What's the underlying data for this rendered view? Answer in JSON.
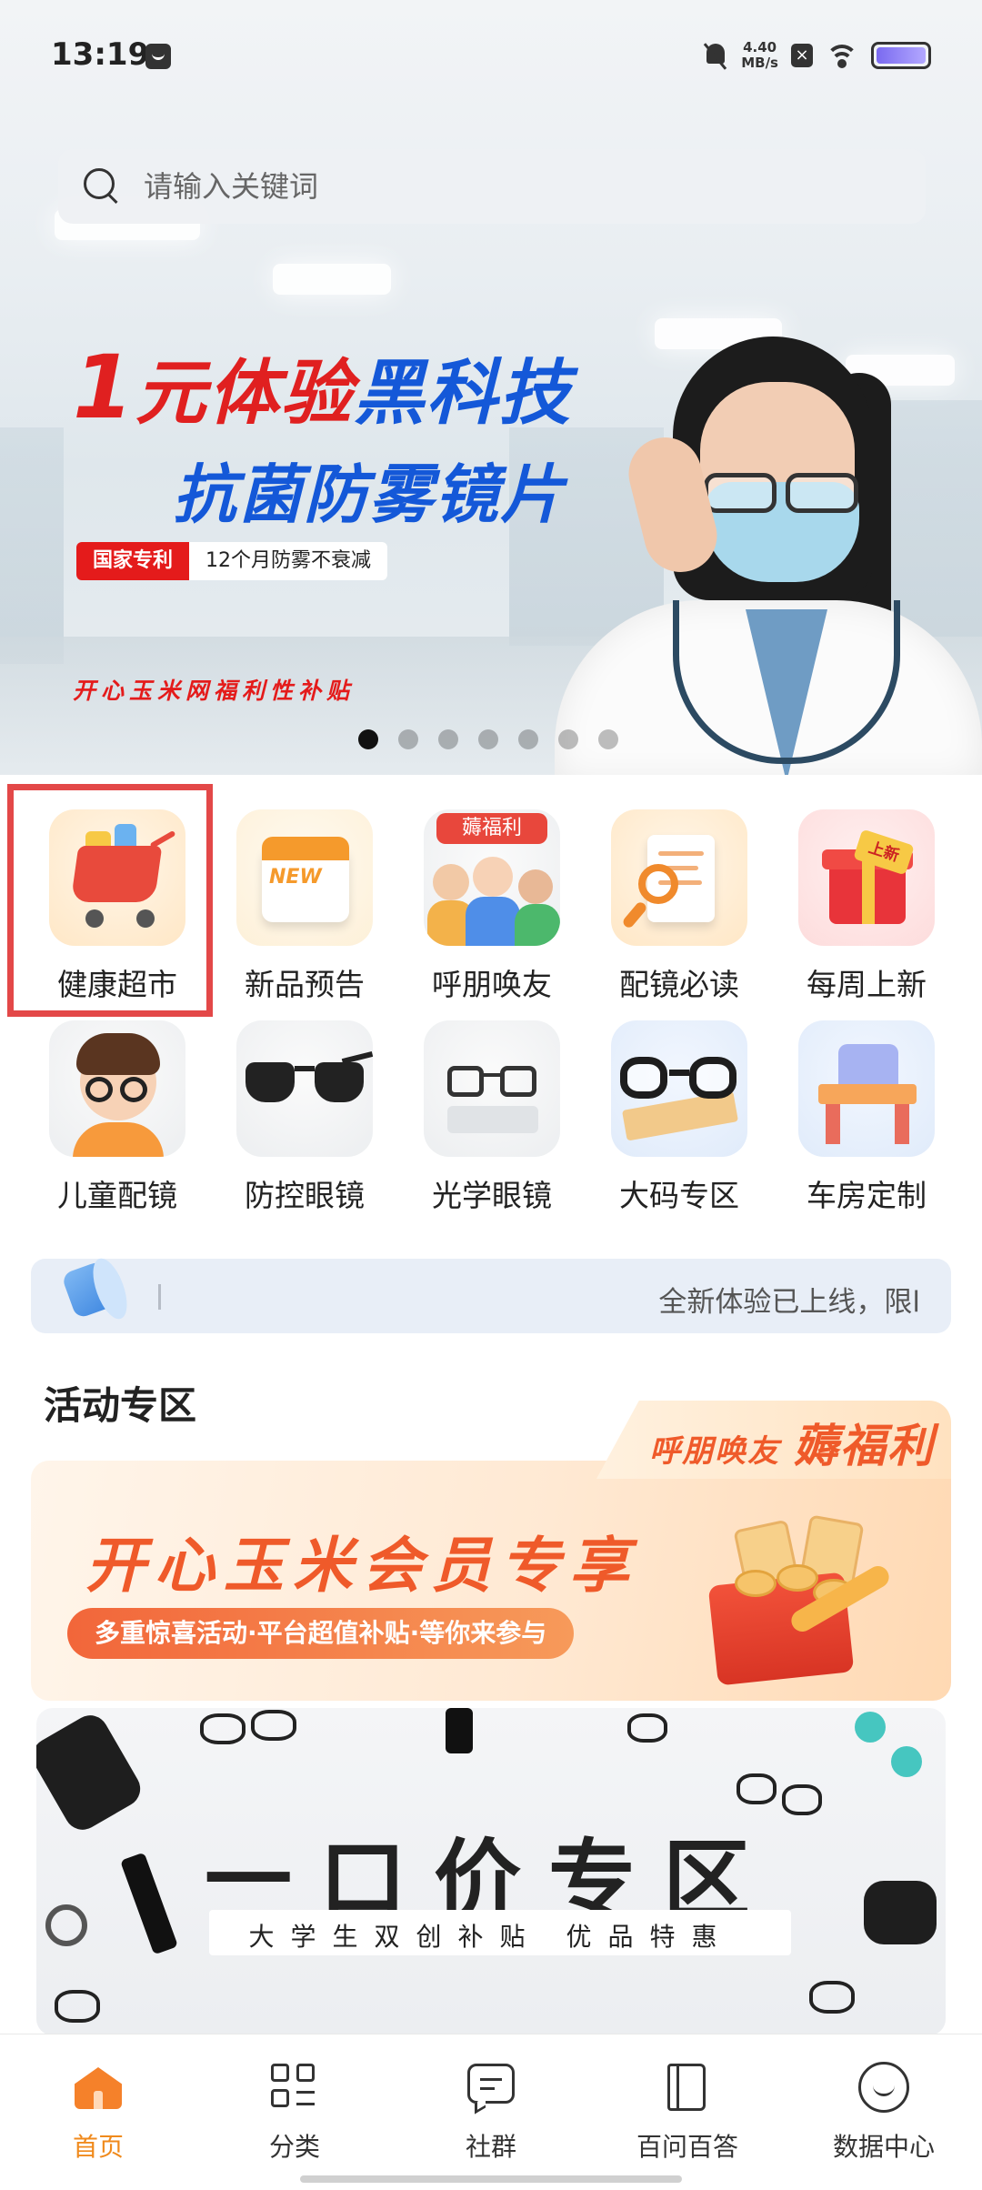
{
  "status_bar": {
    "time": "13:19",
    "net_speed_value": "4.40",
    "net_speed_unit": "MB/s",
    "icons": [
      "message-icon",
      "bell-off-icon",
      "close-box-icon",
      "wifi-icon",
      "battery-icon"
    ]
  },
  "search": {
    "placeholder": "请输入关键词"
  },
  "banner": {
    "headline_num": "1",
    "headline_red": "元体验",
    "headline_blue": "黑科技",
    "headline_line2": "抗菌防雾镜片",
    "tag_red": "国家专利",
    "tag_white": "12个月防雾不衰减",
    "slogan": "开心玉米网福利性补贴",
    "dots_total": 7,
    "dots_active_index": 0
  },
  "grid": {
    "items": [
      {
        "label": "健康超市",
        "icon": "shopping-cart-icon"
      },
      {
        "label": "新品预告",
        "icon": "calendar-new-icon",
        "icon_text": "NEW"
      },
      {
        "label": "呼朋唤友",
        "icon": "friends-icon",
        "badge": "薅福利"
      },
      {
        "label": "配镜必读",
        "icon": "document-magnifier-icon"
      },
      {
        "label": "每周上新",
        "icon": "gift-box-icon",
        "icon_text": "上新"
      },
      {
        "label": "儿童配镜",
        "icon": "kid-glasses-icon"
      },
      {
        "label": "防控眼镜",
        "icon": "sunglasses-icon"
      },
      {
        "label": "光学眼镜",
        "icon": "optical-glasses-icon"
      },
      {
        "label": "大码专区",
        "icon": "large-frame-glasses-icon"
      },
      {
        "label": "车房定制",
        "icon": "workshop-machine-icon"
      }
    ]
  },
  "notice": {
    "text": "全新体验已上线，限l",
    "icon": "megaphone-icon"
  },
  "activity": {
    "section_title": "活动专区",
    "tab_text_small": "呼朋唤友",
    "tab_text_big": "薅福利",
    "promo_title": "开心玉米会员专享",
    "promo_pill": "多重惊喜活动·平台超值补贴·等你来参与",
    "yikou_title": "一口价专区",
    "yikou_sub": "大学生双创补贴  优品特惠"
  },
  "bottom_nav": {
    "items": [
      {
        "label": "首页",
        "icon": "home-icon",
        "active": true
      },
      {
        "label": "分类",
        "icon": "category-grid-icon",
        "active": false
      },
      {
        "label": "社群",
        "icon": "chat-icon",
        "active": false
      },
      {
        "label": "百问百答",
        "icon": "book-icon",
        "active": false
      },
      {
        "label": "数据中心",
        "icon": "smile-icon",
        "active": false
      }
    ]
  },
  "colors": {
    "accent_orange": "#f08a1c",
    "banner_red": "#e02020",
    "banner_blue": "#1458d8",
    "highlight_frame": "#e34848"
  }
}
